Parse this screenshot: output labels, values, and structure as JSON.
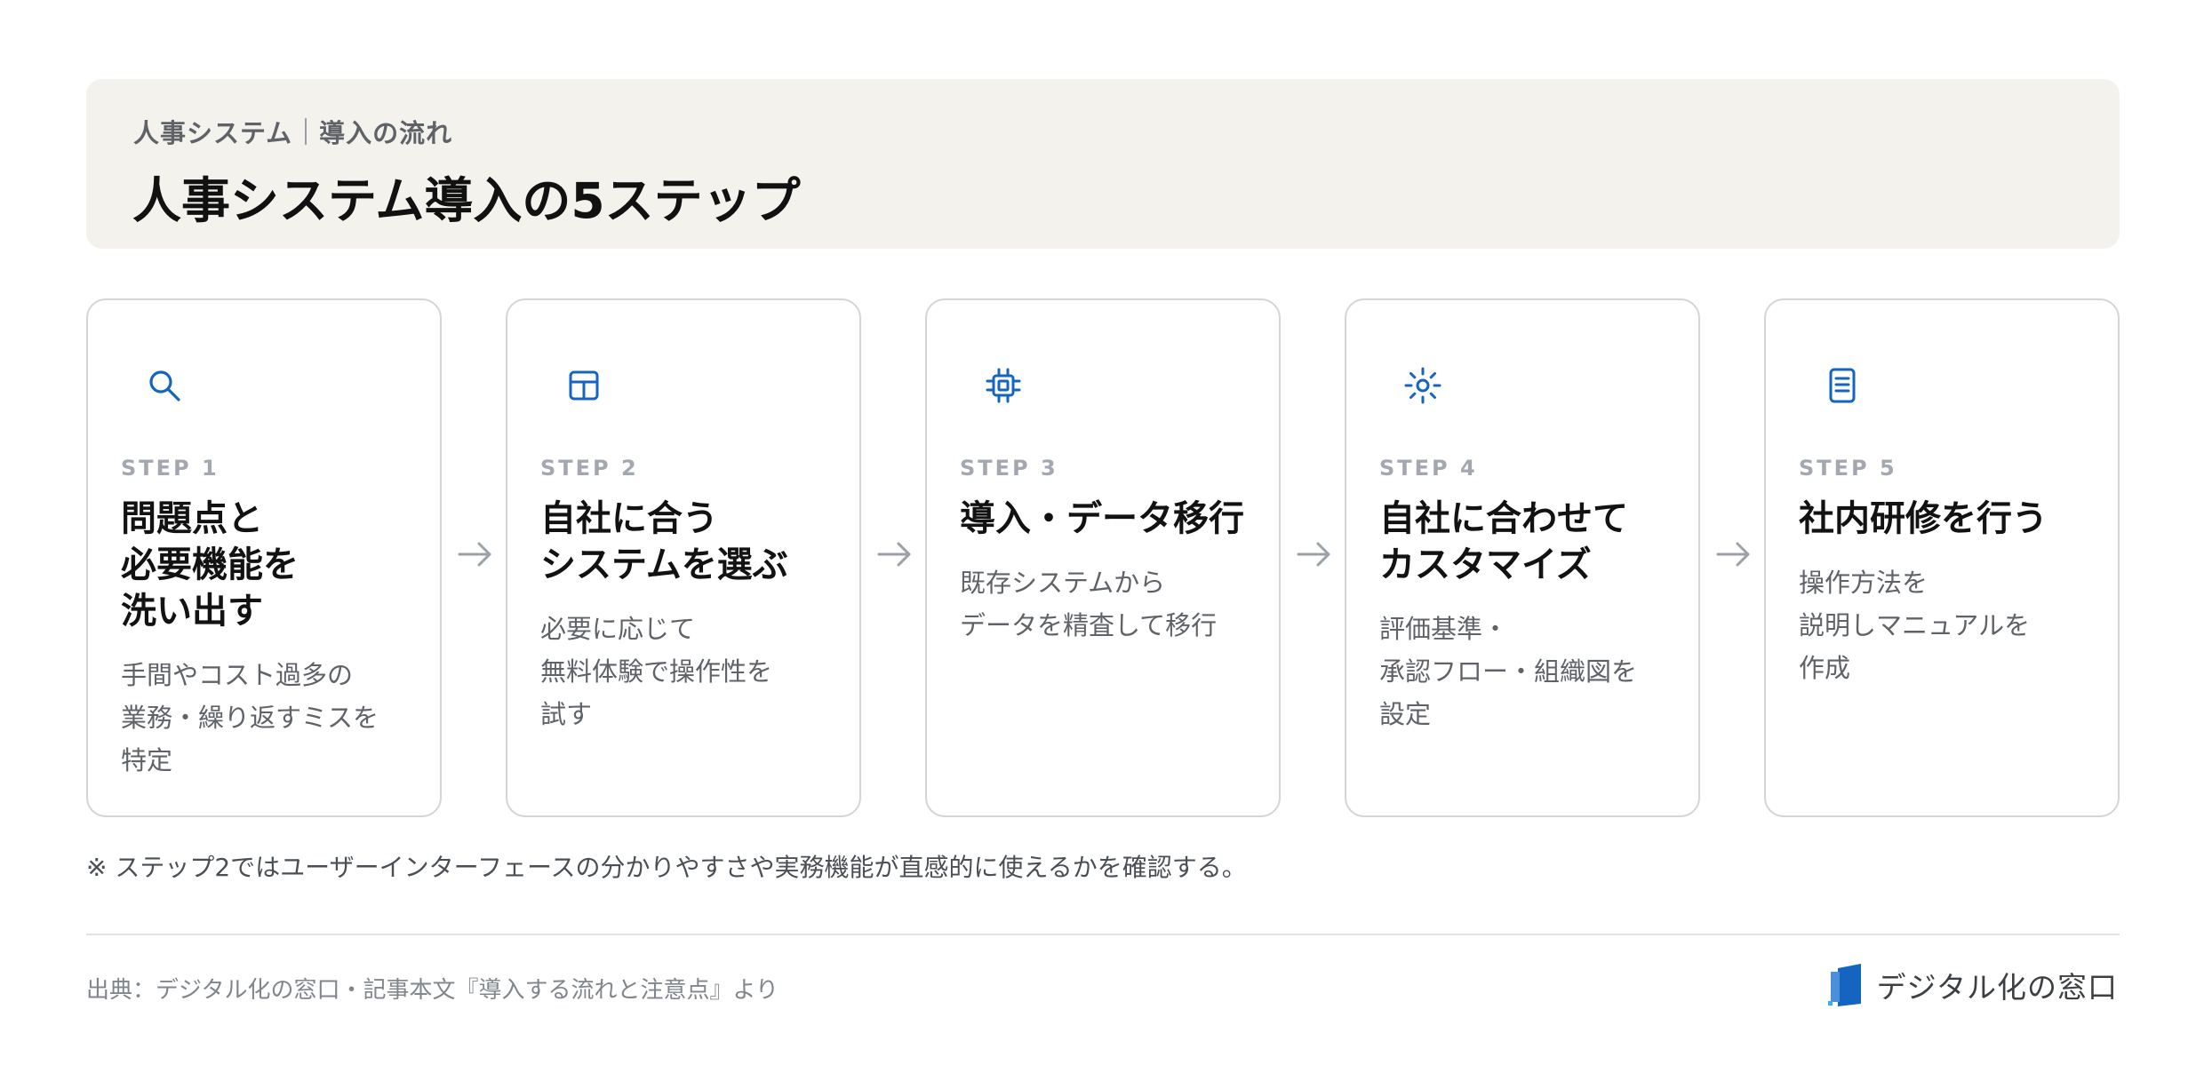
{
  "header": {
    "crumb_left": "人事システム",
    "crumb_right": "導入の流れ",
    "title": "人事システム導入の5ステップ"
  },
  "steps": [
    {
      "icon": "search-icon",
      "label": "STEP 1",
      "title": "問題点と\n必要機能を\n洗い出す",
      "desc": "手間やコスト過多の\n業務・繰り返すミスを\n特定"
    },
    {
      "icon": "table-icon",
      "label": "STEP 2",
      "title": "自社に合う\nシステムを選ぶ",
      "desc": "必要に応じて\n無料体験で操作性を\n試す"
    },
    {
      "icon": "chip-icon",
      "label": "STEP 3",
      "title": "導入・データ移行",
      "desc": "既存システムから\nデータを精査して移行"
    },
    {
      "icon": "sun-gear-icon",
      "label": "STEP 4",
      "title": "自社に合わせて\nカスタマイズ",
      "desc": "評価基準・\n承認フロー・組織図を\n設定"
    },
    {
      "icon": "document-icon",
      "label": "STEP 5",
      "title": "社内研修を行う",
      "desc": "操作方法を\n説明しマニュアルを\n作成"
    }
  ],
  "note": "※ ステップ2ではユーザーインターフェースの分かりやすさや実務機能が直感的に使えるかを確認する。",
  "footer": {
    "source": "出典：デジタル化の窓口・記事本文『導入する流れと注意点』より",
    "brand": "デジタル化の窓口"
  },
  "colors": {
    "accent": "#1565c0",
    "header_bg": "#f4f2ed",
    "card_border": "#d3d5d9",
    "step_label": "#a3a8b0",
    "arrow": "#9aa0a6"
  }
}
